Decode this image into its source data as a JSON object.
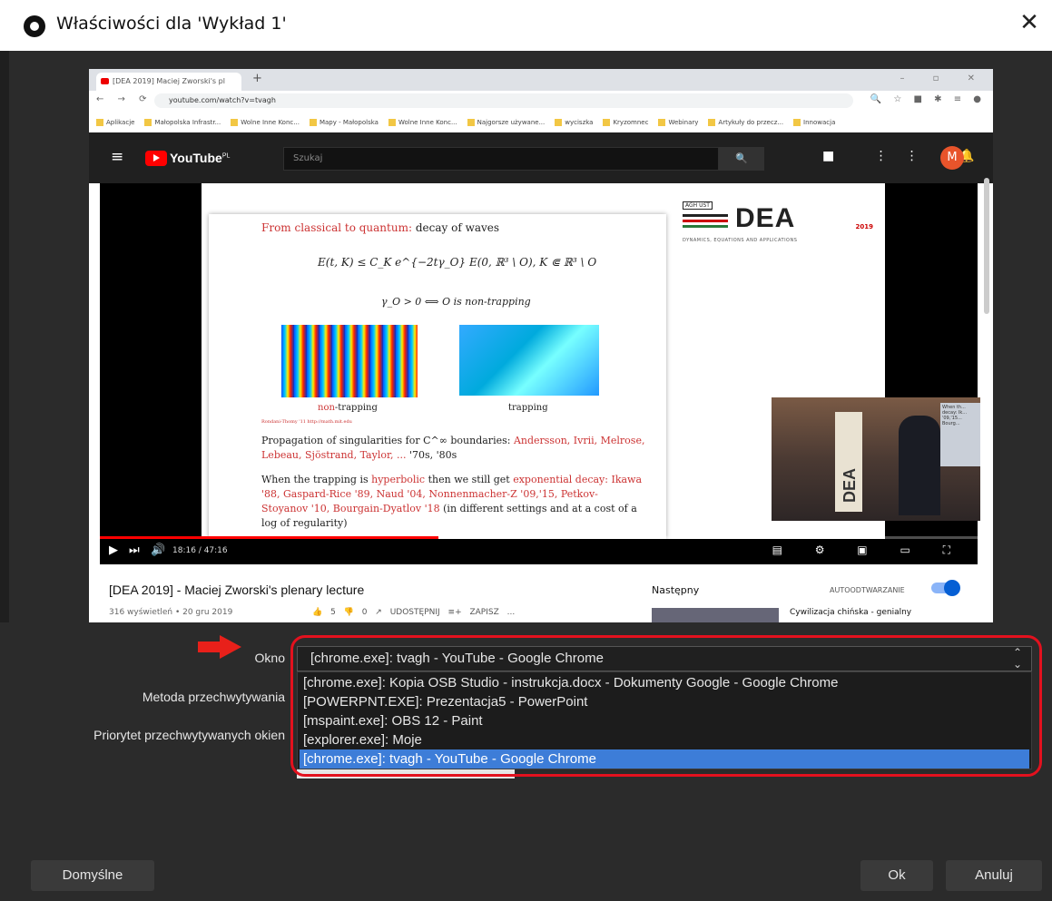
{
  "window": {
    "title": "Właściwości dla 'Wykład 1'",
    "close_label": "✕"
  },
  "browser": {
    "tab_label": "[DEA 2019] Maciej Zworski's pl",
    "url": "youtube.com/watch?v=tvagh",
    "bookmarks": [
      "Aplikacje",
      "Małopolska Infrastr...",
      "Wolne Inne Konc...",
      "Mapy - Małopolska",
      "Wolne Inne Konc...",
      "Najgorsze używane...",
      "wyciszka",
      "Kryzomnec",
      "Webinary",
      "Artykuły do przecz...",
      "Innowacja"
    ]
  },
  "youtube": {
    "logo_text": "YouTube",
    "logo_region": "PL",
    "search_placeholder": "Szukaj",
    "avatar_letter": "M",
    "video_time": "18:16 / 47:16",
    "progress_fraction": 0.386,
    "video_title": "[DEA 2019] - Maciej Zworski's plenary lecture",
    "video_meta": "316 wyświetleń • 20 gru 2019",
    "actions": "👍 5   👎 0   ↗ UDOSTĘPNIJ   ≡+ ZAPISZ   ...",
    "next_label": "Następny",
    "autoplay_label": "AUTOODTWARZANIE",
    "next_video_title": "Cywilizacja chińska - genialny"
  },
  "slide": {
    "title_red": "From classical to quantum:",
    "title_rest": "decay of waves",
    "formula1": "E(t, K) ≤ C_K e^{−2tγ_O} E(0, ℝ³ \\ O),   K ⋐ ℝ³ \\ O",
    "formula2": "γ_O > 0 ⟺ O is non-trapping",
    "label_nontrap_red": "non",
    "label_nontrap_rest": "-trapping",
    "label_trap": "trapping",
    "cite": "Rondani-Thomy '11  http://math.mit.edu",
    "para1_a": "Propagation of singularities for C^∞ boundaries:",
    "para1_red": "Andersson, Ivrii, Melrose, Lebeau, Sjöstrand, Taylor, ...",
    "para1_b": "'70s, '80s",
    "para2_a": "When the trapping is",
    "para2_red1": "hyperbolic",
    "para2_b": "then we still get",
    "para2_red2": "exponential decay: Ikawa '88, Gaspard-Rice '89, Naud '04, Nonnenmacher-Z '09,'15, Petkov-Stoyanov '10, Bourgain-Dyatlov '18",
    "para2_c": "(in different settings and at a cost of a log of regularity)",
    "logo_agh": "AGH UST",
    "logo_dea": "DEA",
    "logo_year": "2019",
    "logo_sub": "DYNAMICS, EQUATIONS AND APPLICATIONS",
    "inset_banner": "DEA",
    "inset_screen_text": "When th... decay: Ik... '09,'15... Bourg..."
  },
  "form": {
    "window_label": "Okno",
    "method_label": "Metoda przechwytywania",
    "priority_label": "Priorytet przechwytywanych okien",
    "selected_value": "[chrome.exe]: tvagh - YouTube - Google Chrome",
    "options": [
      "[chrome.exe]: Kopia OSB Studio - instrukcja.docx - Dokumenty Google - Google Chrome",
      "[POWERPNT.EXE]: Prezentacja5 - PowerPoint",
      "[mspaint.exe]: OBS 12 - Paint",
      "[explorer.exe]: Moje",
      "[chrome.exe]: tvagh - YouTube - Google Chrome"
    ],
    "selected_option_index": 4
  },
  "buttons": {
    "defaults": "Domyślne",
    "ok": "Ok",
    "cancel": "Anuluj"
  },
  "colors": {
    "highlight": "#e3111e",
    "selection": "#3d7dd8",
    "youtube_red": "#ff0000"
  }
}
